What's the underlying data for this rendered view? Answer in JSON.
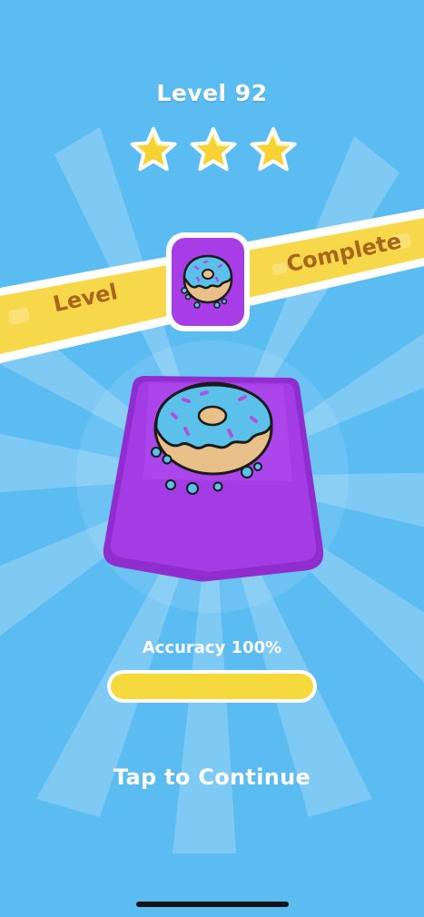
{
  "header": {
    "title": "Level 92"
  },
  "stars": {
    "earned": 3,
    "total": 3,
    "icon": "star-icon",
    "color": "#f7d233"
  },
  "banner": {
    "left_text": "Level",
    "right_text": "Complete",
    "color": "#f7d84a",
    "text_color": "#a8661c"
  },
  "level_icon": {
    "icon": "donut-icon",
    "background": "#a83de8"
  },
  "keycap": {
    "icon": "donut-icon",
    "color": "#a43ce6",
    "frosting_color": "#5bc0ea"
  },
  "accuracy": {
    "label": "Accuracy 100%",
    "progress": 1.0,
    "bar_color": "#f6d93c"
  },
  "footer": {
    "continue_label": "Tap to Continue"
  },
  "theme": {
    "background": "#5bbcf2"
  }
}
